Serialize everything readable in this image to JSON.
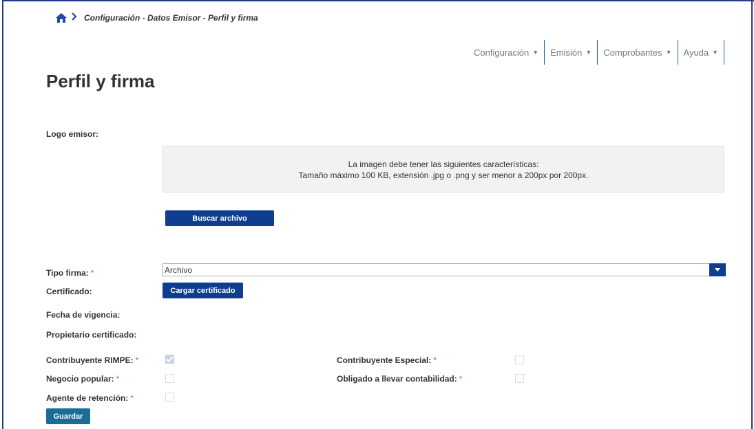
{
  "breadcrumb": {
    "home_icon": "home-icon",
    "separator_icon": "chevron-right-icon",
    "text": "Configuración - Datos Emisor - Perfil y firma"
  },
  "menu": [
    {
      "label": "Configuración"
    },
    {
      "label": "Emisión"
    },
    {
      "label": "Comprobantes"
    },
    {
      "label": "Ayuda"
    }
  ],
  "page_title": "Perfil y firma",
  "logo": {
    "label": "Logo emisor:",
    "info_line1": "La imagen debe tener las siguientes características:",
    "info_line2": "Tamaño máximo 100 KB, extensión .jpg o .png y ser menor a 200px por 200px.",
    "browse_button": "Buscar archivo"
  },
  "form": {
    "tipo_firma_label": "Tipo firma:",
    "tipo_firma_value": "Archivo",
    "certificado_label": "Certificado:",
    "cargar_button": "Cargar certificado",
    "fecha_label": "Fecha de vigencia:",
    "propietario_label": "Propietario certificado:",
    "required_mark": "*",
    "rimpe_label": "Contribuyente RIMPE:",
    "rimpe_checked": true,
    "especial_label": "Contribuyente Especial:",
    "especial_checked": false,
    "popular_label": "Negocio popular:",
    "popular_checked": false,
    "contabilidad_label": "Obligado a llevar contabilidad:",
    "contabilidad_checked": false,
    "retencion_label": "Agente de retención:",
    "retencion_checked": false,
    "save_button": "Guardar"
  },
  "colors": {
    "primary": "#0f3d8f",
    "teal": "#1b6d96",
    "required": "#d9534f",
    "breadcrumb_icon": "#1c4d9c"
  }
}
